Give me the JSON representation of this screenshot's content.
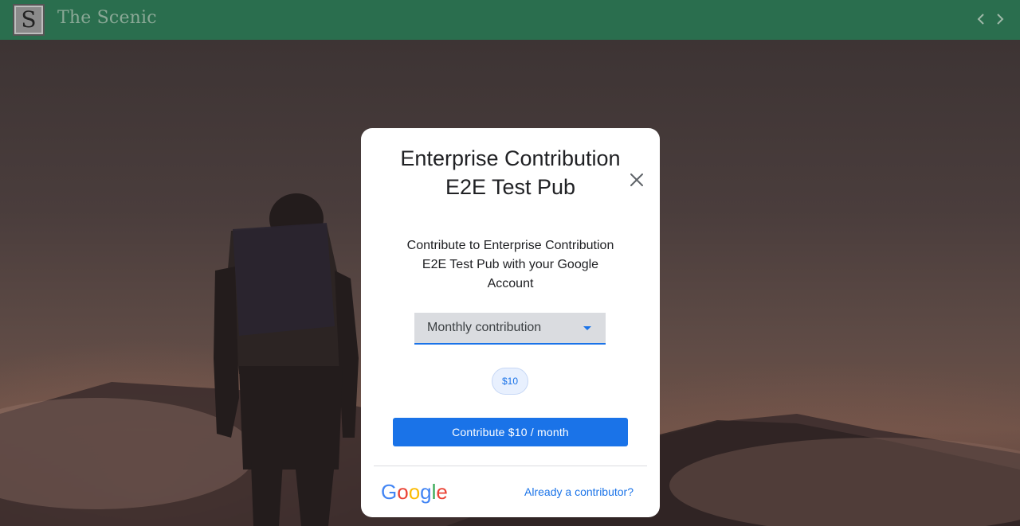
{
  "header": {
    "logo_letter": "S",
    "site_title": "The Scenic",
    "prev_icon": "chevron-left-icon",
    "next_icon": "chevron-right-icon",
    "background_color": "#2a6e4e"
  },
  "dialog": {
    "title": "Enterprise Contribution E2E Test Pub",
    "subtitle": "Contribute to Enterprise Contribution E2E Test Pub with your Google Account",
    "close_icon": "close-icon",
    "frequency_select": {
      "selected": "Monthly contribution"
    },
    "amounts": [
      "$10"
    ],
    "contribute_label": "Contribute $10 / month",
    "google_logo": "Google",
    "already_contributor": "Already a contributor?"
  },
  "colors": {
    "accent": "#1a73e8",
    "header": "#2a6e4e"
  }
}
